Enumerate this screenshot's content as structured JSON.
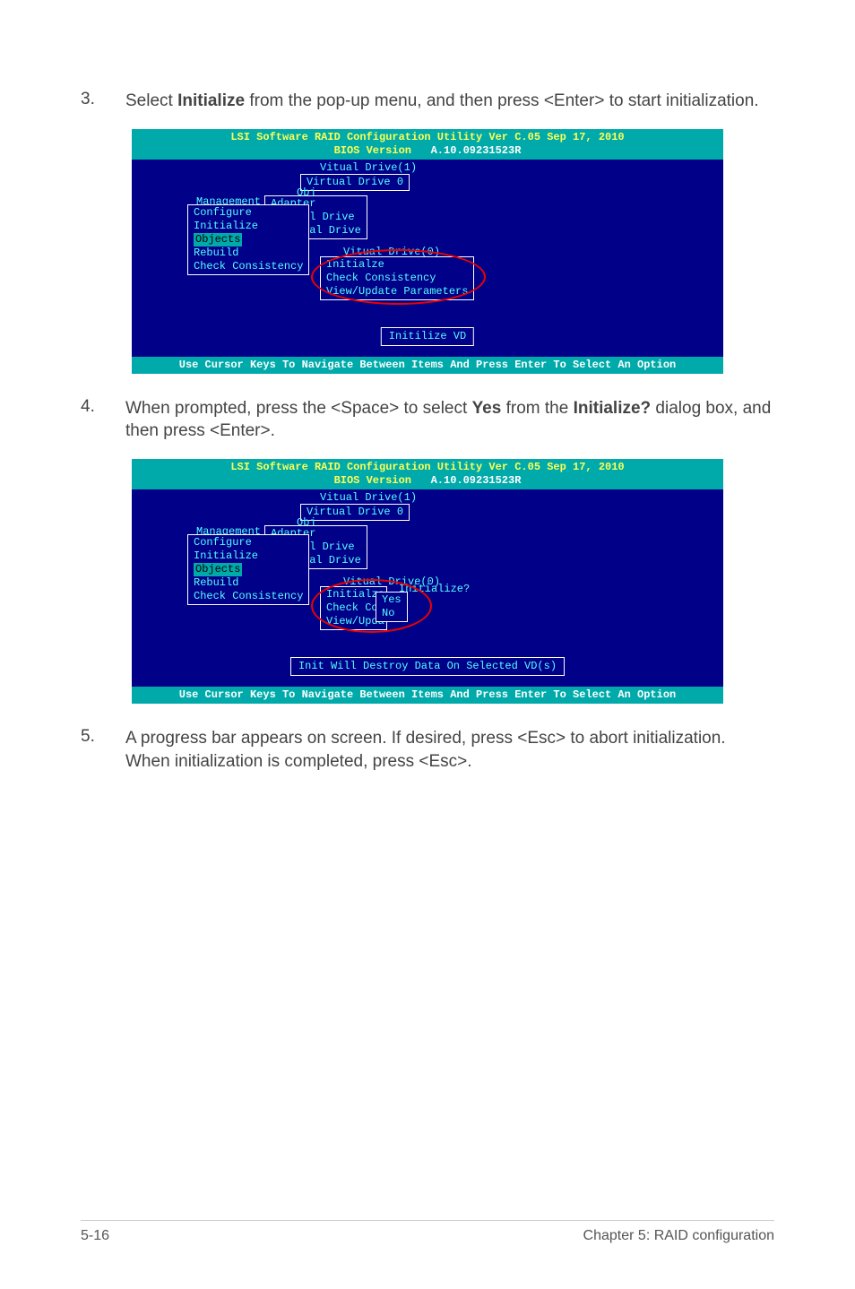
{
  "step3": {
    "num": "3.",
    "text_a": "Select ",
    "bold_a": "Initialize",
    "text_b": " from the pop-up menu, and then press <Enter> to start initialization."
  },
  "step4": {
    "num": "4.",
    "text_a": "When prompted, press the <Space> to select ",
    "bold_a": "Yes",
    "text_b": " from the ",
    "bold_b": "Initialize?",
    "text_c": " dialog box, and then press <Enter>."
  },
  "step5": {
    "num": "5.",
    "text": "A progress bar appears on screen. If desired, press <Esc> to abort initialization. When initialization is completed, press <Esc>."
  },
  "bios": {
    "title_a": "LSI Software RAID Configuration Utility Ver C.05 Sep 17, 2010",
    "title_b1": "BIOS Version",
    "title_b2": "A.10.09231523R",
    "vd_label": "Vitual Drive(1)",
    "vd_box": "Virtual Drive 0",
    "obj_label": "Obj",
    "mgmt_label": "Management",
    "mgmt": {
      "configure": "Configure",
      "initialize": "Initialize",
      "objects": "Objects",
      "rebuild": "Rebuild",
      "check": "Check Consistency"
    },
    "sub": {
      "adapter": "Adapter",
      "vdrive": "Virtual Drive",
      "pdrive": "Physical Drive"
    },
    "vd0_label": "Vitual Drive(0)",
    "vd0": {
      "initialize": "Initialze",
      "check": "Check Consistency",
      "view": "View/Update Parameters"
    },
    "vd0b": {
      "initialize": "Initialze",
      "check": "Check Con",
      "view": "View/Upda"
    },
    "init_label": "Initialize?",
    "init": {
      "yes": "Yes",
      "no": "No"
    },
    "status1": "Initilize VD",
    "status2": "Init Will Destroy Data On Selected VD(s)",
    "footer": "Use Cursor Keys To Navigate Between Items And Press Enter To Select An Option"
  },
  "page_footer": {
    "left": "5-16",
    "right": "Chapter 5: RAID configuration"
  }
}
